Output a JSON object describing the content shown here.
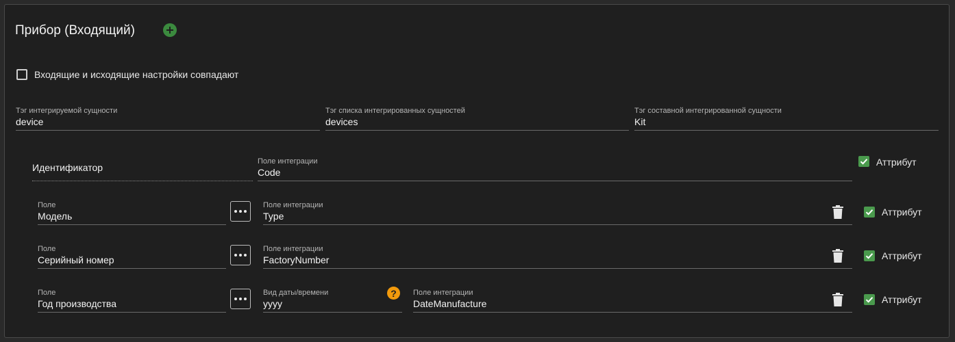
{
  "header": {
    "title": "Прибор (Входящий)",
    "add_icon": "plus-circle-icon"
  },
  "same_settings": {
    "label": "Входящие и исходящие настройки совпадают",
    "checked": false
  },
  "tags": [
    {
      "label": "Тэг интегрируемой сущности",
      "value": "device"
    },
    {
      "label": "Тэг списка интегрированных сущностей",
      "value": "devices"
    },
    {
      "label": "Тэг составной интегрированной сущности",
      "value": "Kit"
    }
  ],
  "identifier": {
    "label": "Идентификатор",
    "integration_label": "Поле интеграции",
    "integration_value": "Code",
    "attribute_label": "Аттрибут",
    "attribute_checked": true
  },
  "rows": [
    {
      "field_label": "Поле",
      "field_value": "Модель",
      "integration_label": "Поле интеграции",
      "integration_value": "Type",
      "attribute_label": "Аттрибут",
      "attribute_checked": true
    },
    {
      "field_label": "Поле",
      "field_value": "Серийный номер",
      "integration_label": "Поле интеграции",
      "integration_value": "FactoryNumber",
      "attribute_label": "Аттрибут",
      "attribute_checked": true
    },
    {
      "field_label": "Поле",
      "field_value": "Год производства",
      "datetime_label": "Вид даты/времени",
      "datetime_value": "yyyy",
      "integration_label": "Поле интеграции",
      "integration_value": "DateManufacture",
      "attribute_label": "Аттрибут",
      "attribute_checked": true
    }
  ],
  "help_glyph": "?",
  "colors": {
    "accent_green": "#4a9a4d",
    "help_orange": "#f29a0c",
    "background": "#1f1f1f"
  }
}
